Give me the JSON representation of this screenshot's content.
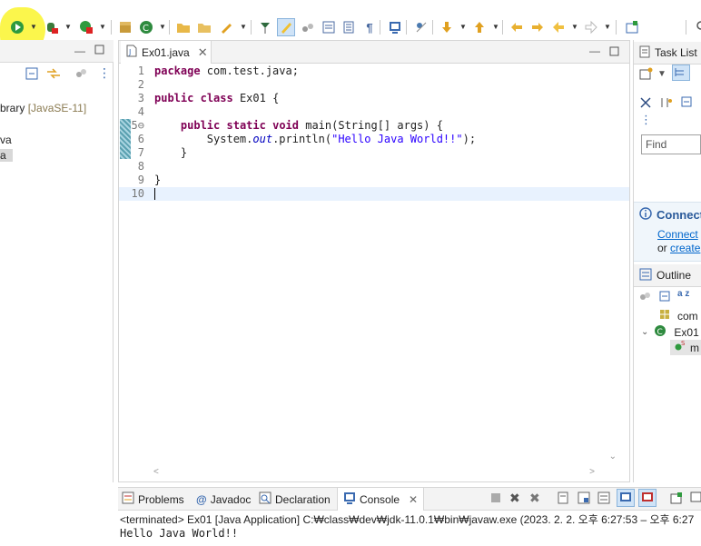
{
  "toolbar": {
    "icons": {
      "run": "run-icon",
      "debug": "debug-icon",
      "coverage": "coverage-icon"
    }
  },
  "left_panel": {
    "library_label": "brary",
    "library_suffix": "[JavaSE-11]",
    "item_va": "va",
    "item_a": "a"
  },
  "editor": {
    "tab_label": "Ex01.java",
    "lines": [
      {
        "no": "1",
        "parts": [
          {
            "t": "package",
            "c": "kw"
          },
          {
            "t": " com.test.java;",
            "c": ""
          }
        ]
      },
      {
        "no": "2",
        "parts": []
      },
      {
        "no": "3",
        "parts": [
          {
            "t": "public",
            "c": "kw"
          },
          {
            "t": " ",
            "c": ""
          },
          {
            "t": "class",
            "c": "kw"
          },
          {
            "t": " Ex01 {",
            "c": ""
          }
        ]
      },
      {
        "no": "4",
        "parts": []
      },
      {
        "no": "5⊖",
        "parts": [
          {
            "t": "    ",
            "c": ""
          },
          {
            "t": "public",
            "c": "kw"
          },
          {
            "t": " ",
            "c": ""
          },
          {
            "t": "static",
            "c": "kw"
          },
          {
            "t": " ",
            "c": ""
          },
          {
            "t": "void",
            "c": "kw"
          },
          {
            "t": " main(String[] args) {",
            "c": ""
          }
        ]
      },
      {
        "no": "6",
        "parts": [
          {
            "t": "        System.",
            "c": ""
          },
          {
            "t": "out",
            "c": "fld"
          },
          {
            "t": ".println(",
            "c": ""
          },
          {
            "t": "\"Hello Java World!!\"",
            "c": "str"
          },
          {
            "t": ");",
            "c": ""
          }
        ]
      },
      {
        "no": "7",
        "parts": [
          {
            "t": "    }",
            "c": ""
          }
        ]
      },
      {
        "no": "8",
        "parts": []
      },
      {
        "no": "9",
        "parts": [
          {
            "t": "}",
            "c": ""
          }
        ]
      },
      {
        "no": "10",
        "parts": []
      }
    ]
  },
  "right_panel": {
    "task_list_label": "Task List",
    "find_placeholder": "Find",
    "connect_title": "Connect",
    "connect_link": "Connect",
    "or_text": "or",
    "create_link": "create",
    "outline_label": "Outline",
    "outline_item_1": "com",
    "outline_item_2": "Ex01",
    "outline_item_3": "m",
    "sort_label": "a z"
  },
  "console": {
    "tabs": [
      "Problems",
      "Javadoc",
      "Declaration",
      "Console"
    ],
    "status": "<terminated> Ex01 [Java Application] C:₩class₩dev₩jdk-11.0.1₩bin₩javaw.exe  (2023. 2. 2. 오후 6:27:53 – 오후 6:27",
    "output": "Hello Java World!!"
  },
  "colors": {
    "keyword": "#7f0055",
    "string": "#2a00ff",
    "field": "#0000c0",
    "highlight": "#fbf542",
    "link": "#0066cc"
  }
}
